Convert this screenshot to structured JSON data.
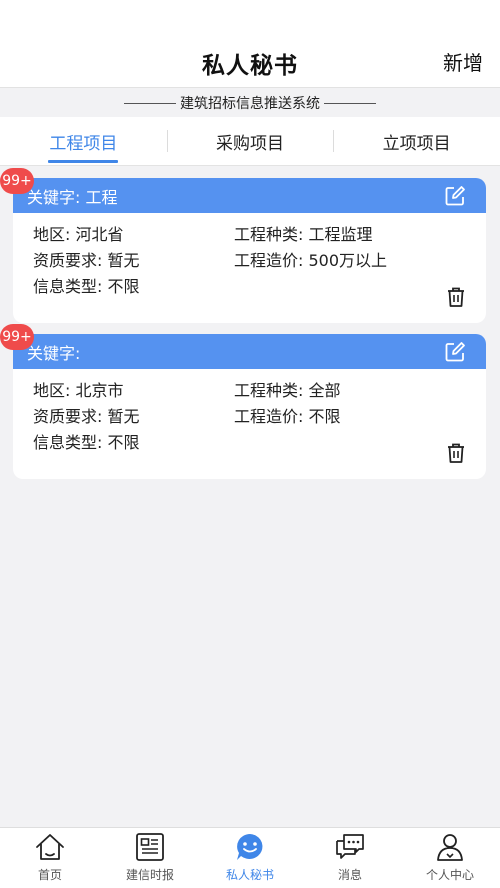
{
  "header": {
    "title": "私人秘书",
    "add_label": "新增"
  },
  "subtitle": "建筑招标信息推送系统",
  "tabs": [
    {
      "label": "工程项目",
      "active": true
    },
    {
      "label": "采购项目",
      "active": false
    },
    {
      "label": "立项项目",
      "active": false
    }
  ],
  "cards": [
    {
      "badge": "99+",
      "keyword": "关键字: 工程",
      "region": "地区: 河北省",
      "category": "工程种类: 工程监理",
      "qualification": "资质要求: 暂无",
      "cost": "工程造价: 500万以上",
      "info_type": "信息类型: 不限"
    },
    {
      "badge": "99+",
      "keyword": "关键字:",
      "region": "地区: 北京市",
      "category": "工程种类: 全部",
      "qualification": "资质要求: 暂无",
      "cost": "工程造价: 不限",
      "info_type": "信息类型: 不限"
    }
  ],
  "tabbar": [
    {
      "label": "首页",
      "icon": "home-icon"
    },
    {
      "label": "建信时报",
      "icon": "newspaper-icon"
    },
    {
      "label": "私人秘书",
      "icon": "smiley-chat-icon",
      "active": true
    },
    {
      "label": "消息",
      "icon": "message-icon"
    },
    {
      "label": "个人中心",
      "icon": "user-icon"
    }
  ],
  "colors": {
    "accent": "#3f86e8",
    "card_header": "#5592f0",
    "badge": "#ef4b4b"
  }
}
